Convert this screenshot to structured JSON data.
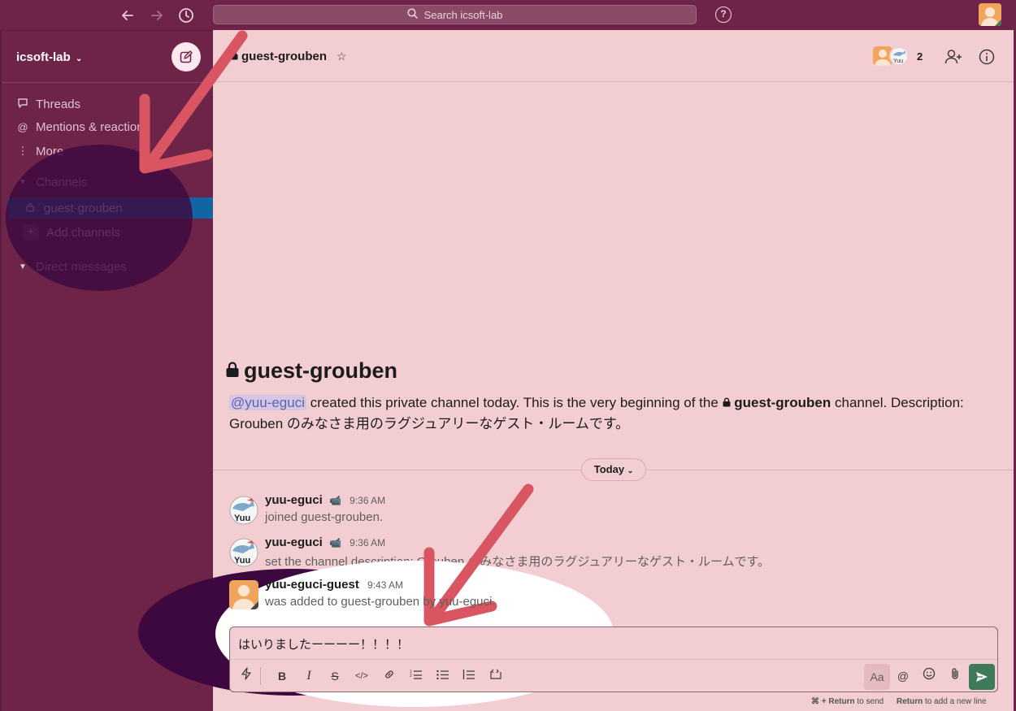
{
  "topbar": {
    "search_placeholder": "Search icsoft-lab",
    "help_label": "?"
  },
  "sidebar": {
    "workspace": "icsoft-lab",
    "items": [
      {
        "label": "Threads",
        "icon": "threads-icon"
      },
      {
        "label": "Mentions & reactions",
        "icon": "at-icon"
      },
      {
        "label": "More",
        "icon": "more-icon"
      }
    ],
    "channels_header": "Channels",
    "active_channel": "guest-grouben",
    "add_channels": "Add channels",
    "dm_header": "Direct messages"
  },
  "channel": {
    "name": "guest-grouben",
    "member_count": "2"
  },
  "intro": {
    "title": "guest-grouben",
    "mention": "@yuu-eguci",
    "text_a": " created this private channel today. This is the very beginning of the ",
    "channel": "guest-grouben",
    "text_b": " channel. Description: Grouben のみなさま用のラグジュアリーなゲスト・ルームです。"
  },
  "day_divider": "Today",
  "messages": [
    {
      "name": "yuu-eguci",
      "badge": "📹",
      "time": "9:36 AM",
      "body": "joined guest-grouben."
    },
    {
      "name": "yuu-eguci",
      "badge": "📹",
      "time": "9:36 AM",
      "body": "set the channel description: Grouben のみなさま用のラグジュアリーなゲスト・ルームです。"
    },
    {
      "name": "yuu-eguci-guest",
      "badge": "",
      "time": "9:43 AM",
      "body": "was added to guest-grouben by yuu-eguci."
    }
  ],
  "composer": {
    "text": "はいりましたーーーー！！！！",
    "aa_label": "Aa",
    "hint_send_key": "⌘ + Return",
    "hint_send": " to send",
    "hint_newline_key": "Return",
    "hint_newline": " to add a new line"
  },
  "colors": {
    "sidebar": "#6e2449",
    "active": "#1264a3",
    "main_bg": "#f2cdd1",
    "send": "#3f7a5a",
    "annotation_arrow": "#d95562",
    "annotation_dark": "#3d0840"
  }
}
